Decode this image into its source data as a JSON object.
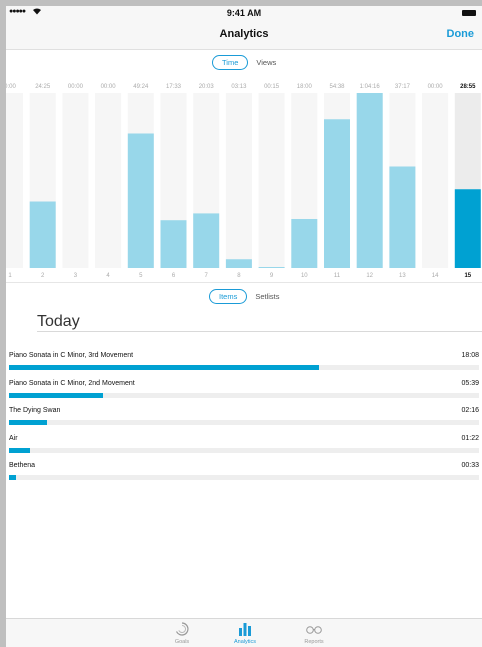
{
  "status_bar": {
    "signal": "●●●●●",
    "time": "9:41 AM"
  },
  "navbar": {
    "title": "Analytics",
    "done_label": "Done"
  },
  "chart_switch": {
    "active": "Time",
    "inactive": "Views"
  },
  "list_switch": {
    "active": "Items",
    "inactive": "Setlists"
  },
  "chart_data": {
    "type": "bar",
    "categories": [
      "1",
      "2",
      "3",
      "4",
      "5",
      "6",
      "7",
      "8",
      "9",
      "10",
      "11",
      "12",
      "13",
      "14",
      "15"
    ],
    "top_labels": [
      "0:00",
      "24:25",
      "00:00",
      "00:00",
      "49:24",
      "17:33",
      "20:03",
      "03:13",
      "00:15",
      "18:00",
      "54:38",
      "1:04:16",
      "37:17",
      "00:00",
      "28:55"
    ],
    "values_minutes": [
      0,
      24.42,
      0,
      0,
      49.4,
      17.55,
      20.05,
      3.22,
      0.25,
      18.0,
      54.63,
      64.27,
      37.28,
      0,
      28.92
    ],
    "ylim": [
      0,
      64.27
    ],
    "selected_index": 14,
    "colors": {
      "bar": "#98d7ea",
      "selected_bar": "#00a1d2",
      "background_column": "#f6f6f6",
      "selected_background": "#ececec"
    }
  },
  "section": {
    "title": "Today"
  },
  "items": [
    {
      "name": "Piano Sonata in C Minor, 3rd Movement",
      "duration": "18:08",
      "fraction": 0.66
    },
    {
      "name": "Piano Sonata in C Minor, 2nd Movement",
      "duration": "05:39",
      "fraction": 0.2
    },
    {
      "name": "The Dying Swan",
      "duration": "02:16",
      "fraction": 0.08
    },
    {
      "name": "Air",
      "duration": "01:22",
      "fraction": 0.045
    },
    {
      "name": "Bethena",
      "duration": "00:33",
      "fraction": 0.015
    }
  ],
  "tabbar": {
    "tabs": [
      {
        "label": "Goals",
        "icon": "goals-ring-icon"
      },
      {
        "label": "Analytics",
        "icon": "bar-chart-icon"
      },
      {
        "label": "Reports",
        "icon": "glasses-icon"
      }
    ],
    "active": "Analytics"
  },
  "colors": {
    "accent": "#1a9bd7",
    "bar_fill": "#00a1d2"
  }
}
